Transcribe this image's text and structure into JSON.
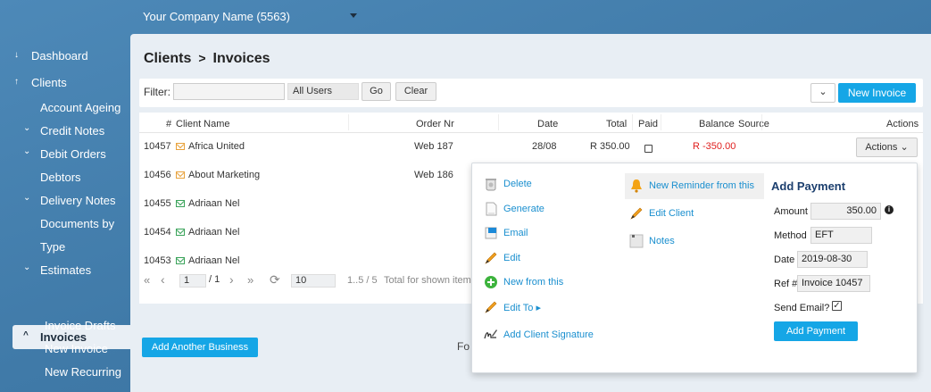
{
  "company": {
    "name": "Your Company Name (5563)"
  },
  "sidebar": {
    "items": [
      {
        "label": "Dashboard",
        "arrow": "↓"
      },
      {
        "label": "Clients",
        "arrow": "↑"
      },
      {
        "label": "Account Ageing"
      },
      {
        "label": "Credit Notes",
        "arrow": "⌄"
      },
      {
        "label": "Debit Orders",
        "arrow": "⌄"
      },
      {
        "label": "Debtors"
      },
      {
        "label": "Delivery Notes",
        "arrow": "⌄"
      },
      {
        "label": "Documents by"
      },
      {
        "label": "Type"
      },
      {
        "label": "Estimates",
        "arrow": "⌄"
      },
      {
        "label": "Invoices",
        "arrow": "^"
      },
      {
        "label": "Invoice Drafts"
      },
      {
        "label": "New Invoice"
      },
      {
        "label": "New Recurring"
      }
    ]
  },
  "breadcrumb": {
    "parent": "Clients",
    "sep": ">",
    "current": "Invoices"
  },
  "filter": {
    "label": "Filter:",
    "value": "",
    "users": "All Users",
    "go": "Go",
    "clear": "Clear",
    "menu_caret": "⌄",
    "new_invoice": "New Invoice"
  },
  "table": {
    "headers": {
      "num": "#",
      "client": "Client Name",
      "order": "Order Nr",
      "date": "Date",
      "total": "Total",
      "paid": "Paid",
      "balance": "Balance",
      "source": "Source",
      "actions": "Actions"
    },
    "rows": [
      {
        "num": "10457",
        "client": "Africa United",
        "order": "Web 187",
        "date": "28/08",
        "total": "R 350.00",
        "balance": "R -350.00",
        "actions": "Actions ⌄"
      },
      {
        "num": "10456",
        "client": "About Marketing",
        "order": "Web 186"
      },
      {
        "num": "10455",
        "client": "Adriaan Nel"
      },
      {
        "num": "10454",
        "client": "Adriaan Nel"
      },
      {
        "num": "10453",
        "client": "Adriaan Nel"
      }
    ]
  },
  "pager": {
    "first": "«",
    "prev": "‹",
    "page": "1",
    "of": "/ 1",
    "next": "›",
    "last": "»",
    "refresh": "⟳",
    "per_page": "10",
    "range": "1..5 / 5",
    "total_note": "Total for shown item"
  },
  "add_business": "Add Another Business",
  "footer_fragment": "Fo",
  "menu": {
    "col1": [
      {
        "label": "Delete"
      },
      {
        "label": "Generate"
      },
      {
        "label": "Email"
      },
      {
        "label": "Edit"
      },
      {
        "label": "New from this"
      },
      {
        "label": "Edit To ▸"
      },
      {
        "label": "Add Client Signature"
      }
    ],
    "col2": [
      {
        "label": "New Reminder from this"
      },
      {
        "label": "Edit Client"
      },
      {
        "label": "Notes"
      }
    ]
  },
  "add_payment": {
    "title": "Add Payment",
    "amount_label": "Amount",
    "amount": "350.00",
    "method_label": "Method",
    "method": "EFT",
    "date_label": "Date",
    "date": "2019-08-30",
    "ref_label": "Ref #",
    "ref": "Invoice 10457",
    "send_label": "Send Email?",
    "button": "Add Payment"
  }
}
